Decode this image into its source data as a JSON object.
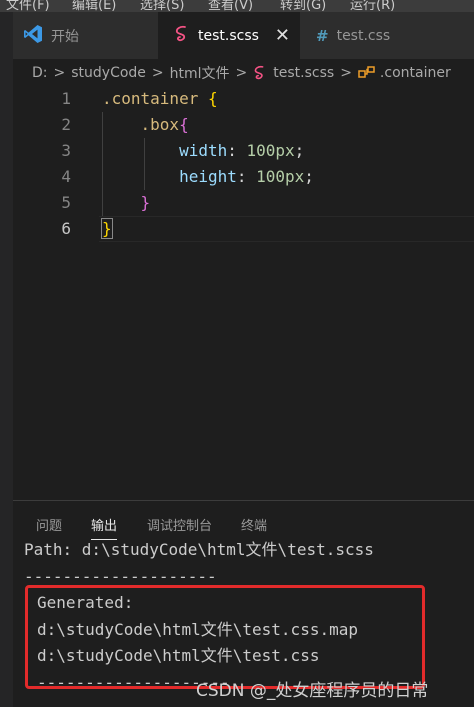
{
  "menu": [
    "文件(F)",
    "编辑(E)",
    "选择(S)",
    "查看(V)",
    "转到(G)",
    "运行(R)"
  ],
  "tabs": {
    "start": {
      "icon": "vscode-logo-icon",
      "label": "开始"
    },
    "scss": {
      "icon": "sass-icon",
      "label": "test.scss",
      "close": "✕"
    },
    "css": {
      "icon": "hash-icon",
      "label": "test.css"
    }
  },
  "breadcrumb": {
    "drive": "D:",
    "folder1": "studyCode",
    "folder2": "html文件",
    "file": "test.scss",
    "symbol": ".container",
    "sep": ">"
  },
  "editor": {
    "lines": [
      {
        "n": "1",
        "parts": [
          [
            ".container",
            "sel"
          ],
          [
            " ",
            "punc"
          ],
          [
            "{",
            "brace"
          ]
        ]
      },
      {
        "n": "2",
        "parts": [
          [
            "    .box",
            "sel"
          ],
          [
            "{",
            "brace2"
          ]
        ]
      },
      {
        "n": "3",
        "parts": [
          [
            "        width",
            "prop"
          ],
          [
            ": ",
            "punc"
          ],
          [
            "100px",
            "num"
          ],
          [
            ";",
            "punc"
          ]
        ]
      },
      {
        "n": "4",
        "parts": [
          [
            "        height",
            "prop"
          ],
          [
            ": ",
            "punc"
          ],
          [
            "100px",
            "num"
          ],
          [
            ";",
            "punc"
          ]
        ]
      },
      {
        "n": "5",
        "parts": [
          [
            "    ",
            "punc"
          ],
          [
            "}",
            "brace2"
          ]
        ]
      },
      {
        "n": "6",
        "parts": [
          [
            "}",
            "brace"
          ]
        ]
      }
    ]
  },
  "panel": {
    "tabs": [
      "问题",
      "输出",
      "调试控制台",
      "终端"
    ],
    "active_tab": "输出",
    "output": [
      "Path: d:\\studyCode\\html文件\\test.scss",
      "--------------------",
      "Generated:",
      "d:\\studyCode\\html文件\\test.css.map",
      "d:\\studyCode\\html文件\\test.css",
      "--------------------"
    ]
  },
  "watermark": "CSDN @_处女座程序员的日常",
  "colors": {
    "accent_red": "#e32b2b",
    "selector": "#d7ba7d",
    "property": "#9cdcfe",
    "number": "#b5cea8"
  }
}
